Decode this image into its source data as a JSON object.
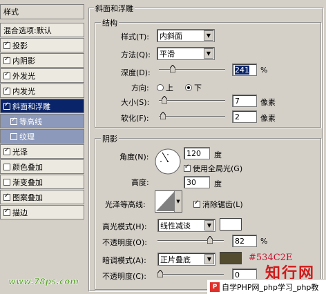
{
  "sidebar": {
    "title": "样式",
    "blend": "混合选项:默认",
    "items": [
      {
        "label": "投影",
        "checked": true,
        "state": "normal"
      },
      {
        "label": "内阴影",
        "checked": true,
        "state": "normal"
      },
      {
        "label": "外发光",
        "checked": true,
        "state": "normal"
      },
      {
        "label": "内发光",
        "checked": true,
        "state": "normal"
      },
      {
        "label": "斜面和浮雕",
        "checked": true,
        "state": "selected"
      },
      {
        "label": "等高线",
        "checked": true,
        "state": "sub"
      },
      {
        "label": "纹理",
        "checked": false,
        "state": "sub"
      },
      {
        "label": "光泽",
        "checked": true,
        "state": "normal"
      },
      {
        "label": "颜色叠加",
        "checked": false,
        "state": "normal"
      },
      {
        "label": "渐变叠加",
        "checked": false,
        "state": "normal"
      },
      {
        "label": "图案叠加",
        "checked": true,
        "state": "normal"
      },
      {
        "label": "描边",
        "checked": true,
        "state": "normal"
      }
    ],
    "watermark": "www.78ps.com"
  },
  "bevel": {
    "title": "斜面和浮雕",
    "structure": {
      "title": "结构",
      "style_label": "样式(T):",
      "style_value": "内斜面",
      "technique_label": "方法(Q):",
      "technique_value": "平滑",
      "depth_label": "深度(D):",
      "depth_value": "241",
      "depth_unit": "%",
      "depth_level": 0.18,
      "direction_label": "方向:",
      "dir_up": "上",
      "dir_down": "下",
      "size_label": "大小(S):",
      "size_value": "7",
      "size_unit": "像素",
      "size_level": 0.04,
      "soften_label": "软化(F):",
      "soften_value": "2",
      "soften_unit": "像素",
      "soften_level": 0.02
    },
    "shading": {
      "title": "阴影",
      "angle_label": "角度(N):",
      "angle_value": "120",
      "angle_unit": "度",
      "global_light": "使用全局光(G)",
      "altitude_label": "高度:",
      "altitude_value": "30",
      "altitude_unit": "度",
      "gloss_label": "光泽等高线:",
      "anti_alias": "消除锯齿(L)",
      "highlight_label": "高光模式(H):",
      "highlight_value": "线性减淡",
      "highlight_color": "#ffffff",
      "opacity1_label": "不透明度(O):",
      "opacity1_value": "82",
      "opacity1_unit": "%",
      "opacity1_level": 0.82,
      "shadow_label": "暗调模式(A):",
      "shadow_value": "正片叠底",
      "shadow_color": "#534C2E",
      "shadow_color_text": "#534C2E",
      "opacity2_label": "不透明度(C):",
      "opacity2_value": "0",
      "opacity2_level": 0.0
    }
  },
  "overlay": {
    "logo_text": "知行网",
    "banner_text": "自学PHP网_php学习_php教"
  }
}
